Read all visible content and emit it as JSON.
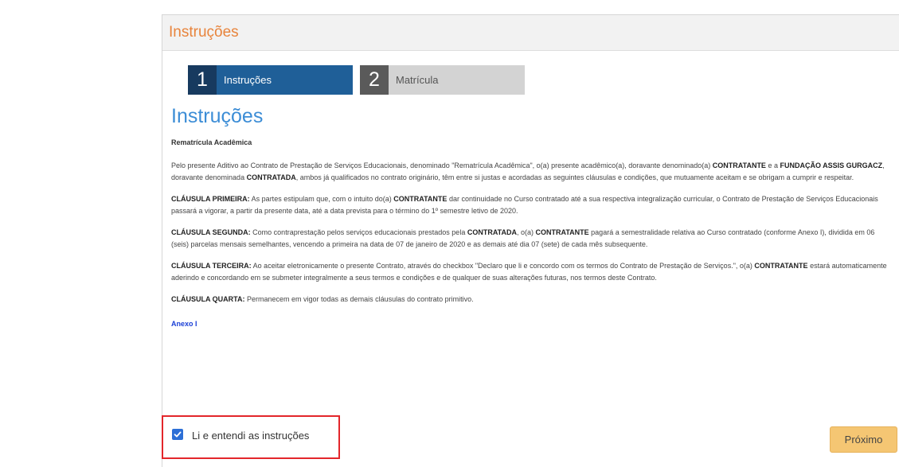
{
  "header": {
    "title": "Instruções"
  },
  "steps": [
    {
      "number": "1",
      "label": "Instruções",
      "state": "active"
    },
    {
      "number": "2",
      "label": "Matrícula",
      "state": "inactive"
    }
  ],
  "content": {
    "section_title": "Instruções",
    "doc_title": "Rematrícula Acadêmica",
    "p1": {
      "a": "Pelo presente Aditivo ao Contrato de Prestação de Serviços Educacionais, denominado \"Rematrícula Acadêmica\", o(a) presente acadêmico(a), doravante denominado(a) ",
      "b": "CONTRATANTE",
      "c": " e a ",
      "d": "FUNDAÇÃO ASSIS GURGACZ",
      "e": ", doravante denominada ",
      "f": "CONTRATADA",
      "g": ", ambos já qualificados no contrato originário, têm entre si justas e acordadas as seguintes cláusulas e condições, que mutuamente aceitam e se obrigam a cumprir e respeitar."
    },
    "p2": {
      "a": "CLÁUSULA PRIMEIRA:",
      "b": " As partes estipulam que, com o intuito do(a) ",
      "c": "CONTRATANTE",
      "d": " dar continuidade no Curso contratado até a sua respectiva integralização curricular, o Contrato de Prestação de Serviços Educacionais passará a vigorar, a partir da presente data, até a data prevista para o término do 1º semestre letivo de 2020."
    },
    "p3": {
      "a": "CLÁUSULA SEGUNDA:",
      "b": " Como contraprestação pelos serviços educacionais prestados pela ",
      "c": "CONTRATADA",
      "d": ", o(a) ",
      "e": "CONTRATANTE",
      "f": " pagará a semestralidade relativa ao Curso contratado (conforme Anexo I), dividida em 06 (seis) parcelas mensais semelhantes, vencendo a primeira na data de 07 de janeiro de 2020 e as demais até dia 07 (sete) de cada mês subsequente."
    },
    "p4": {
      "a": "CLÁUSULA TERCEIRA:",
      "b": " Ao aceitar eletronicamente o presente Contrato, através do checkbox \"Declaro que li e concordo com os termos do Contrato de Prestação de Serviços.\", o(a) ",
      "c": "CONTRATANTE",
      "d": " estará automaticamente aderindo e concordando em se submeter integralmente a seus termos e condições e de qualquer de suas alterações futuras, nos termos deste Contrato."
    },
    "p5": {
      "a": "CLÁUSULA QUARTA:",
      "b": " Permanecem em vigor todas as demais cláusulas do contrato primitivo."
    },
    "annex_link": "Anexo I"
  },
  "confirm": {
    "label": "Li e entendi as instruções",
    "checked": true
  },
  "next_button": {
    "label": "Próximo"
  },
  "colors": {
    "header_title": "#e8843c",
    "step_active": "#1f5f98",
    "step_inactive": "#d3d3d3",
    "section_title": "#3c8dd6",
    "link": "#1a3fd6",
    "highlight_border": "#e3262b",
    "next_button": "#f5c673"
  }
}
